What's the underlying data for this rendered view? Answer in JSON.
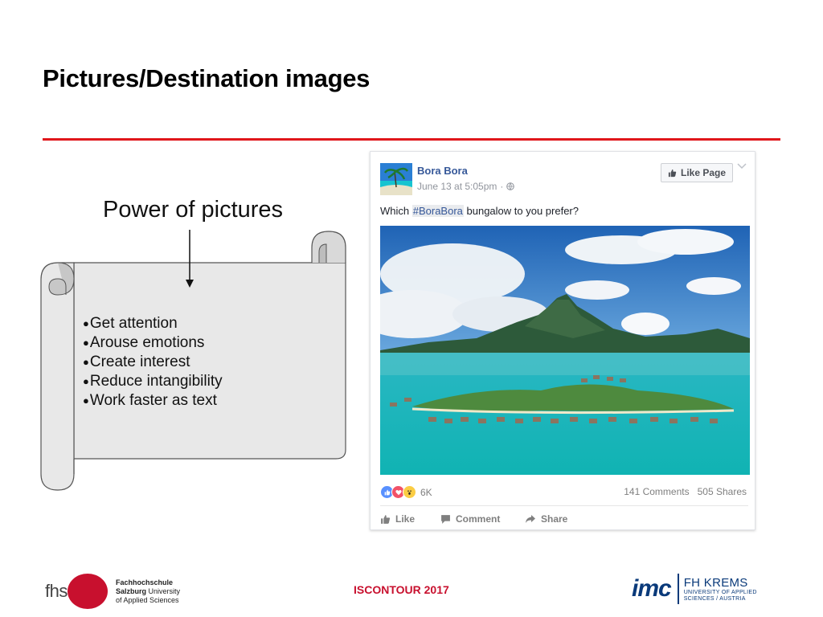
{
  "slide": {
    "title": "Pictures/Destination images",
    "power_label": "Power of pictures",
    "bullet_symbol": "●",
    "bullets": [
      "Get attention",
      "Arouse emotions",
      "Create interest",
      "Reduce intangibility",
      "Work faster as text"
    ],
    "accent_color": "#e0161b"
  },
  "fb_post": {
    "page_name": "Bora Bora",
    "timestamp": "June 13 at 5:05pm",
    "meta_separator": "·",
    "like_page_label": "Like Page",
    "text_before": "Which ",
    "hashtag": "#BoraBora",
    "text_after": " bungalow to you prefer?",
    "reaction_count": "6K",
    "comments": "141 Comments",
    "shares": "505 Shares",
    "actions": {
      "like": "Like",
      "comment": "Comment",
      "share": "Share"
    },
    "icons": [
      "globe-icon",
      "thumbs-up-icon",
      "heart-icon",
      "wow-icon",
      "comment-icon",
      "share-icon",
      "chevron-down-icon"
    ]
  },
  "footer": {
    "left_logo_word": "fhs",
    "left_logo_line1": "Fachhochschule",
    "left_logo_line2_bold": "Salzburg",
    "left_logo_line2_rest": " University",
    "left_logo_line3": "of Applied Sciences",
    "center_text": "ISCONTOUR 2017",
    "imc_logo": "imc",
    "krems_main": "FH KREMS",
    "krems_sub1": "UNIVERSITY OF APPLIED",
    "krems_sub2": "SCIENCES / AUSTRIA",
    "brand_red": "#c8102e",
    "brand_blue": "#0a3a7a"
  }
}
